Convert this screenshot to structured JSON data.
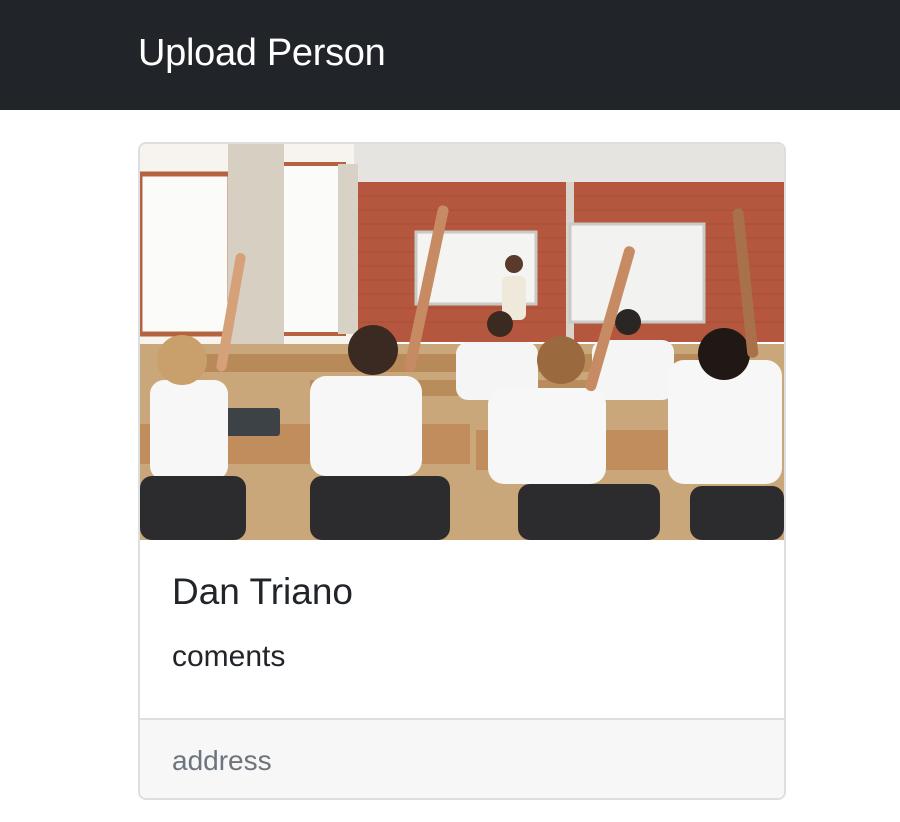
{
  "navbar": {
    "brand": "Upload Person"
  },
  "card": {
    "image": {
      "icon": "classroom-photo",
      "alt": ""
    },
    "name": "Dan Triano",
    "comments": "coments",
    "footer": "address"
  },
  "colors": {
    "navbar_bg": "#212529",
    "navbar_text": "#ffffff",
    "card_border": "#dcdfe2",
    "footer_bg": "#f7f7f7",
    "muted_text": "#6c757d"
  }
}
